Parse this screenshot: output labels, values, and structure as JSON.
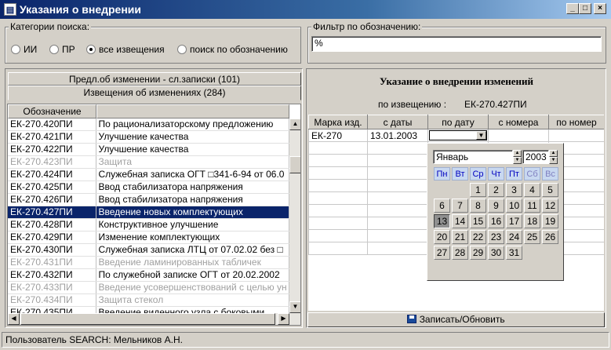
{
  "window": {
    "title": "Указания о внедрении",
    "buttons": {
      "minimize": "_",
      "maximize": "□",
      "close": "×"
    }
  },
  "search_categories": {
    "label": "Категории поиска:",
    "options": [
      "ИИ",
      "ПР",
      "все извещения",
      "поиск по обозначению"
    ],
    "selected": "все извещения"
  },
  "filter": {
    "label": "Фильтр по обозначению:",
    "value": "%"
  },
  "left_tabs": {
    "tab1": "Предл.об изменении - сл.записки (101)",
    "tab2": "Извещения об изменениях (284)"
  },
  "list": {
    "headers": [
      "Обозначение",
      ""
    ],
    "rows": [
      {
        "code": "ЕК-270.420ПИ",
        "desc": "По рационализаторскому предложению",
        "state": "normal"
      },
      {
        "code": "ЕК-270.421ПИ",
        "desc": "Улучшение качества",
        "state": "normal"
      },
      {
        "code": "ЕК-270.422ПИ",
        "desc": "Улучшение качества",
        "state": "normal"
      },
      {
        "code": "ЕК-270.423ПИ",
        "desc": "Защита",
        "state": "gray"
      },
      {
        "code": "ЕК-270.424ПИ",
        "desc": "Служебная записка ОГТ □341-6-94 от 06.0",
        "state": "normal"
      },
      {
        "code": "ЕК-270.425ПИ",
        "desc": "Ввод стабилизатора напряжения",
        "state": "normal"
      },
      {
        "code": "ЕК-270.426ПИ",
        "desc": "Ввод стабилизатора напряжения",
        "state": "normal"
      },
      {
        "code": "ЕК-270.427ПИ",
        "desc": "Введение новых комплектующих",
        "state": "sel"
      },
      {
        "code": "ЕК-270.428ПИ",
        "desc": "Конструктивное улучшение",
        "state": "normal"
      },
      {
        "code": "ЕК-270.429ПИ",
        "desc": "Изменение комплектующих",
        "state": "normal"
      },
      {
        "code": "ЕК-270.430ПИ",
        "desc": "Служебная записка ЛТЦ от 07.02.02 без □",
        "state": "normal"
      },
      {
        "code": "ЕК-270.431ПИ",
        "desc": "Введение ламинированных табличек",
        "state": "gray"
      },
      {
        "code": "ЕК-270.432ПИ",
        "desc": "По служебной записке ОГТ от 20.02.2002",
        "state": "normal"
      },
      {
        "code": "ЕК-270.433ПИ",
        "desc": "Введение усовершенствований с целью ун",
        "state": "gray"
      },
      {
        "code": "ЕК-270.434ПИ",
        "desc": "Защита стекол",
        "state": "gray"
      },
      {
        "code": "ЕК-270.435ПИ",
        "desc": "Введение виденного узла с боковыми",
        "state": "normal"
      }
    ]
  },
  "detail": {
    "heading": "Указание о внедрении изменений",
    "notice_label": "по извещению :",
    "notice_value": "ЕК-270.427ПИ",
    "columns": [
      "Марка изд.",
      "с даты",
      "по дату",
      "с номера",
      "по номер"
    ],
    "row": {
      "brand": "ЕК-270",
      "from_date": "13.01.2003",
      "to_date": "",
      "from_no": "",
      "to_no": ""
    },
    "save_button": "Записать/Обновить"
  },
  "calendar": {
    "month": "Январь",
    "year": "2003",
    "weekdays": [
      "Пн",
      "Вт",
      "Ср",
      "Чт",
      "Пт",
      "Сб",
      "Вс"
    ],
    "weeks": [
      [
        "",
        "",
        "1",
        "2",
        "3",
        "4",
        "5"
      ],
      [
        "6",
        "7",
        "8",
        "9",
        "10",
        "11",
        "12"
      ],
      [
        "13",
        "14",
        "15",
        "16",
        "17",
        "18",
        "19"
      ],
      [
        "20",
        "21",
        "22",
        "23",
        "24",
        "25",
        "26"
      ],
      [
        "27",
        "28",
        "29",
        "30",
        "31",
        "",
        ""
      ]
    ],
    "selected": "13"
  },
  "status": {
    "text": "Пользователь SEARCH: Мельников А.Н."
  }
}
